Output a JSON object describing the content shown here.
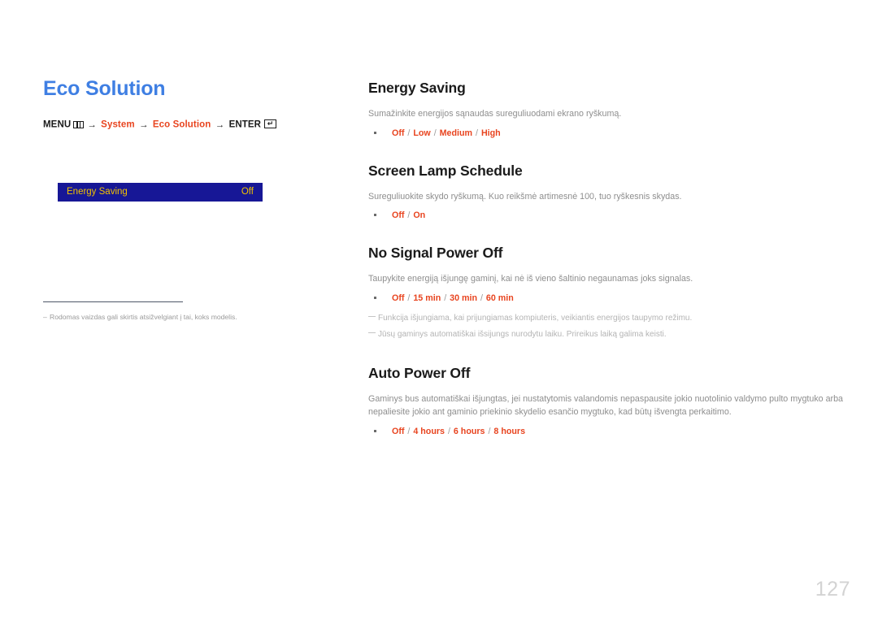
{
  "page": {
    "number": "127",
    "title": "Eco Solution"
  },
  "breadcrumb": {
    "menu_label": "MENU",
    "menu_icon": "menu-grid-icon",
    "arrow": "→",
    "path1": "System",
    "path2": "Eco Solution",
    "enter_label": "ENTER",
    "enter_icon": "enter-key-icon",
    "enter_glyph": "↵"
  },
  "osd": {
    "label": "Energy Saving",
    "value": "Off",
    "bg_color": "#171796",
    "text_color": "#f2c200"
  },
  "left_footnote": {
    "dash": "–",
    "text": "Rodomas vaizdas gali skirtis atsižvelgiant į tai, koks modelis."
  },
  "colors": {
    "title_blue": "#3f7fe3",
    "accent_red": "#e8441f",
    "body_gray": "#8e8e8e",
    "note_gray": "#b4b4b4",
    "page_number_gray": "#d3d3d3"
  },
  "sections": [
    {
      "heading": "Energy Saving",
      "description": "Sumažinkite energijos sąnaudas sureguliuodami ekrano ryškumą.",
      "options": [
        "Off",
        "Low",
        "Medium",
        "High"
      ],
      "notes": []
    },
    {
      "heading": "Screen Lamp Schedule",
      "description": "Sureguliuokite skydo ryškumą. Kuo reikšmė artimesnė 100, tuo ryškesnis skydas.",
      "options": [
        "Off",
        "On"
      ],
      "notes": []
    },
    {
      "heading": "No Signal Power Off",
      "description": "Taupykite energiją išjungę gaminį, kai nė iš vieno šaltinio negaunamas joks signalas.",
      "options": [
        "Off",
        "15 min",
        "30 min",
        "60 min"
      ],
      "notes": [
        "Funkcija išjungiama, kai prijungiamas kompiuteris, veikiantis energijos taupymo režimu.",
        "Jūsų gaminys automatiškai išsijungs nurodytu laiku. Prireikus laiką galima keisti."
      ]
    },
    {
      "heading": "Auto Power Off",
      "description": "Gaminys bus automatiškai išjungtas, jei nustatytomis valandomis nepaspausite jokio nuotolinio valdymo pulto mygtuko arba nepaliesite jokio ant gaminio priekinio skydelio esančio mygtuko, kad būtų išvengta perkaitimo.",
      "options": [
        "Off",
        "4 hours",
        "6 hours",
        "8 hours"
      ],
      "notes": []
    }
  ]
}
